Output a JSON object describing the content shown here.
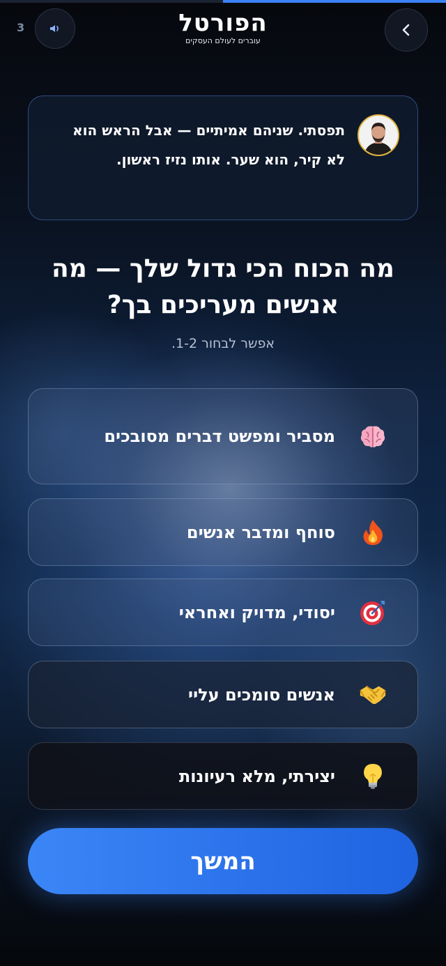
{
  "progress": {
    "fraction": 0.5
  },
  "header": {
    "step_count": "3",
    "logo_title": "הפורטל",
    "logo_subtitle": "עוברים לעולם העסקים",
    "back_icon": "chevron-left-icon",
    "sound_icon": "speaker-icon"
  },
  "message": {
    "text": "תפסתי. שניהם אמיתיים — אבל הראש הוא לא קיר, הוא שער. אותו נזיז ראשון."
  },
  "question": {
    "title": "מה הכוח הכי גדול שלך — מה אנשים מעריכים בך?",
    "hint": "אפשר לבחור 1-2."
  },
  "options": [
    {
      "label": "מסביר ומפשט דברים מסובכים",
      "icon": "brain-icon"
    },
    {
      "label": "סוחף ומדבר אנשים",
      "icon": "fire-icon"
    },
    {
      "label": "יסודי, מדויק ואחראי",
      "icon": "target-icon"
    },
    {
      "label": "אנשים סומכים עליי",
      "icon": "handshake-icon"
    },
    {
      "label": "יצירתי, מלא רעיונות",
      "icon": "lightbulb-icon"
    }
  ],
  "continue_label": "המשך",
  "colors": {
    "accent": "#3b82f6",
    "background": "#0a1220"
  }
}
